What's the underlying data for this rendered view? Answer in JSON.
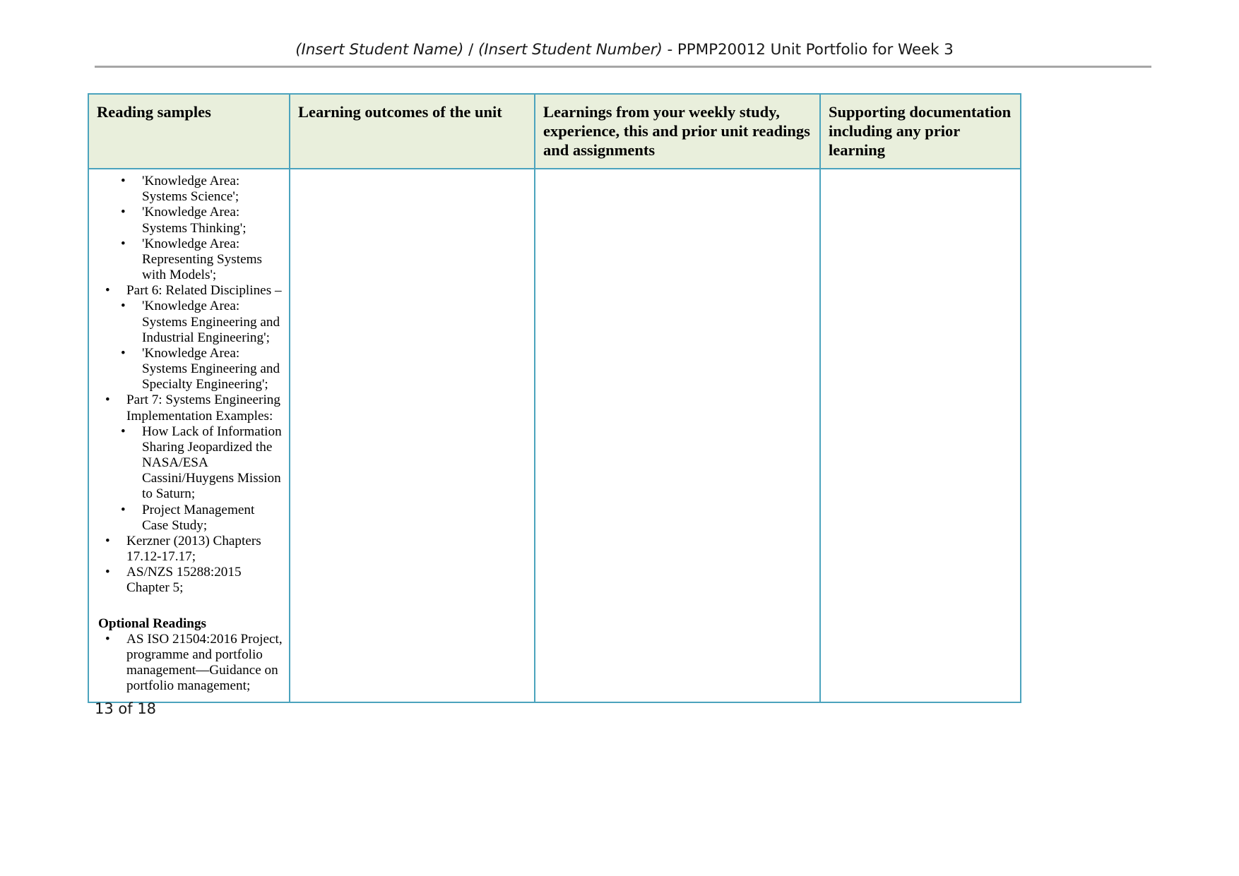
{
  "header": {
    "student_name_placeholder": "(Insert Student Name)",
    "separator": " / ",
    "student_number_placeholder": "(Insert Student Number)",
    "title_suffix": " - PPMP20012 Unit Portfolio for Week 3",
    "full_text": "(Insert Student Name) / (Insert Student Number) - PPMP20012 Unit Portfolio for Week 3"
  },
  "table": {
    "columns": [
      {
        "id": "reading-samples",
        "label": "Reading samples"
      },
      {
        "id": "learning-outcomes",
        "label": "Learning outcomes of the unit"
      },
      {
        "id": "weekly-learnings",
        "label": "Learnings from your weekly study, experience, this and prior unit readings and assignments"
      },
      {
        "id": "supporting-documentation",
        "label": "Supporting documentation including any prior learning"
      }
    ],
    "reading_samples": {
      "items": [
        {
          "level": 2,
          "text": "'Knowledge Area: Systems Science';"
        },
        {
          "level": 2,
          "text": "'Knowledge Area: Systems Thinking';"
        },
        {
          "level": 2,
          "text": "'Knowledge Area: Representing Systems with Models';"
        },
        {
          "level": 1,
          "text": "Part 6: Related Disciplines –"
        },
        {
          "level": 2,
          "text": "'Knowledge Area: Systems Engineering and Industrial Engineering';"
        },
        {
          "level": 2,
          "text": "'Knowledge Area: Systems Engineering and Specialty Engineering';"
        },
        {
          "level": 1,
          "text": "Part 7: Systems Engineering Implementation Examples:"
        },
        {
          "level": 2,
          "text": "How Lack of Information Sharing Jeopardized the NASA/ESA Cassini/Huygens Mission to Saturn;"
        },
        {
          "level": 2,
          "text": "Project Management Case Study;"
        },
        {
          "level": 1,
          "text": "Kerzner (2013) Chapters 17.12-17.17;"
        },
        {
          "level": 1,
          "text": "AS/NZS 15288:2015 Chapter 5;"
        }
      ],
      "optional_heading": "Optional Readings",
      "optional_items": [
        {
          "level": 1,
          "text": "AS ISO 21504:2016 Project, programme and portfolio management—Guidance on portfolio management;"
        }
      ]
    },
    "learning_outcomes_cell": "",
    "weekly_learnings_cell": "",
    "supporting_documentation_cell": ""
  },
  "footer": {
    "page_label": "13 of 18"
  },
  "colors": {
    "header_fill": "#e9efdc",
    "table_border": "#4ba3bd",
    "header_rule": "#a6a6a6",
    "text": "#000000"
  }
}
